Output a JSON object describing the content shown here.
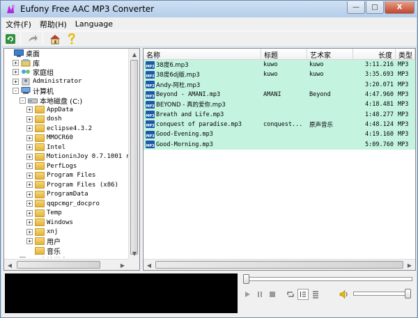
{
  "window": {
    "title": "Eufony Free AAC MP3 Converter",
    "controls": [
      "—",
      "□",
      "X"
    ]
  },
  "menu": [
    {
      "label": "文件(F)"
    },
    {
      "label": "帮助(H)"
    },
    {
      "label": "Language"
    }
  ],
  "toolbar": {
    "buttons": [
      "refresh-icon",
      "forward-icon",
      "home-icon",
      "help-icon"
    ]
  },
  "tree": [
    {
      "label": "桌面",
      "level": 0,
      "expander": "",
      "icon": "desktop-icon"
    },
    {
      "label": "库",
      "level": 1,
      "expander": "+",
      "icon": "library-icon"
    },
    {
      "label": "家庭组",
      "level": 1,
      "expander": "+",
      "icon": "homegroup-icon"
    },
    {
      "label": "Administrator",
      "level": 1,
      "expander": "+",
      "icon": "user-icon"
    },
    {
      "label": "计算机",
      "level": 1,
      "expander": "-",
      "icon": "computer-icon"
    },
    {
      "label": "本地磁盘 (C:)",
      "level": 2,
      "expander": "-",
      "icon": "drive-icon"
    },
    {
      "label": "AppData",
      "level": 3,
      "expander": "+",
      "icon": "folder-icon"
    },
    {
      "label": "dosh",
      "level": 3,
      "expander": "+",
      "icon": "folder-icon"
    },
    {
      "label": "eclipse4.3.2",
      "level": 3,
      "expander": "+",
      "icon": "folder-icon"
    },
    {
      "label": "MMOCR60",
      "level": 3,
      "expander": "+",
      "icon": "folder-icon"
    },
    {
      "label": "Intel",
      "level": 3,
      "expander": "+",
      "icon": "folder-icon"
    },
    {
      "label": "MotioninJoy 0.7.1001 r",
      "level": 3,
      "expander": "+",
      "icon": "folder-icon"
    },
    {
      "label": "PerfLogs",
      "level": 3,
      "expander": "+",
      "icon": "folder-icon"
    },
    {
      "label": "Program Files",
      "level": 3,
      "expander": "+",
      "icon": "folder-icon"
    },
    {
      "label": "Program Files (x86)",
      "level": 3,
      "expander": "+",
      "icon": "folder-icon"
    },
    {
      "label": "ProgramData",
      "level": 3,
      "expander": "+",
      "icon": "folder-icon"
    },
    {
      "label": "qqpcmgr_docpro",
      "level": 3,
      "expander": "+",
      "icon": "folder-icon"
    },
    {
      "label": "Temp",
      "level": 3,
      "expander": "+",
      "icon": "folder-icon"
    },
    {
      "label": "Windows",
      "level": 3,
      "expander": "+",
      "icon": "folder-icon"
    },
    {
      "label": "xnj",
      "level": 3,
      "expander": "+",
      "icon": "folder-icon"
    },
    {
      "label": "用户",
      "level": 3,
      "expander": "+",
      "icon": "folder-icon"
    },
    {
      "label": "音乐",
      "level": 3,
      "expander": "",
      "icon": "folder-icon"
    },
    {
      "label": "本地磁盘 (D:)",
      "level": 2,
      "expander": "+",
      "icon": "drive-icon"
    }
  ],
  "list": {
    "columns": [
      "名称",
      "标题",
      "艺术家",
      "长度",
      "类型"
    ],
    "rows": [
      [
        "38度6.mp3",
        "kuwo",
        "kuwo",
        "3:11.216",
        "MP3"
      ],
      [
        "38度6dj版.mp3",
        "kuwo",
        "kuwo",
        "3:35.693",
        "MP3"
      ],
      [
        "Andy-阿杜.mp3",
        "",
        "",
        "3:20.071",
        "MP3"
      ],
      [
        "Beyond - AMANI.mp3",
        "AMANI",
        "Beyond",
        "4:47.960",
        "MP3"
      ],
      [
        "BEYOND - 真的爱你.mp3",
        "",
        "",
        "4:18.481",
        "MP3"
      ],
      [
        "Breath and Life.mp3",
        "",
        "",
        "1:48.277",
        "MP3"
      ],
      [
        "conquest of paradise.mp3",
        "conquest...",
        "原声音乐",
        "4:48.124",
        "MP3"
      ],
      [
        "Good-Evening.mp3",
        "",
        "",
        "4:19.160",
        "MP3"
      ],
      [
        "Good-Morning.mp3",
        "",
        "",
        "5:09.760",
        "MP3"
      ]
    ],
    "file_badge": "MP3"
  },
  "player": {
    "seek_fraction": 0.0,
    "volume_fraction": 1.0
  },
  "colors": {
    "row_highlight": "#c4f4e0",
    "window_frame": "#b9d1ea"
  }
}
